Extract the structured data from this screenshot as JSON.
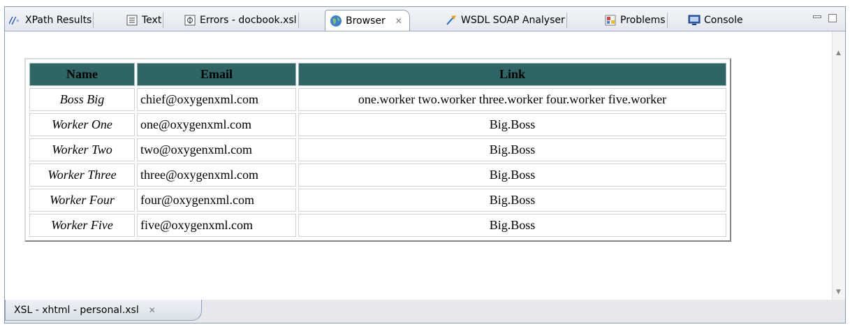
{
  "top_tabs": [
    {
      "label": "XPath Results",
      "icon": "xpath-icon"
    },
    {
      "label": "Text",
      "icon": "text-icon"
    },
    {
      "label": "Errors - docbook.xsl",
      "icon": "errors-icon"
    },
    {
      "label": "Browser",
      "icon": "globe-icon",
      "active": true
    },
    {
      "label": "WSDL SOAP Analyser",
      "icon": "wsdl-icon"
    },
    {
      "label": "Problems",
      "icon": "problems-icon"
    },
    {
      "label": "Console",
      "icon": "console-icon"
    }
  ],
  "table": {
    "headers": [
      "Name",
      "Email",
      "Link"
    ],
    "rows": [
      {
        "name": "Boss Big",
        "email": "chief@oxygenxml.com",
        "link": "one.worker two.worker three.worker four.worker five.worker"
      },
      {
        "name": "Worker One",
        "email": "one@oxygenxml.com",
        "link": "Big.Boss"
      },
      {
        "name": "Worker Two",
        "email": "two@oxygenxml.com",
        "link": "Big.Boss"
      },
      {
        "name": "Worker Three",
        "email": "three@oxygenxml.com",
        "link": "Big.Boss"
      },
      {
        "name": "Worker Four",
        "email": "four@oxygenxml.com",
        "link": "Big.Boss"
      },
      {
        "name": "Worker Five",
        "email": "five@oxygenxml.com",
        "link": "Big.Boss"
      }
    ]
  },
  "bottom_tab": {
    "label": "XSL - xhtml - personal.xsl",
    "icon": "close-icon"
  },
  "colors": {
    "header_bg": "#2f6565",
    "accent_border": "#8fa1b6"
  }
}
